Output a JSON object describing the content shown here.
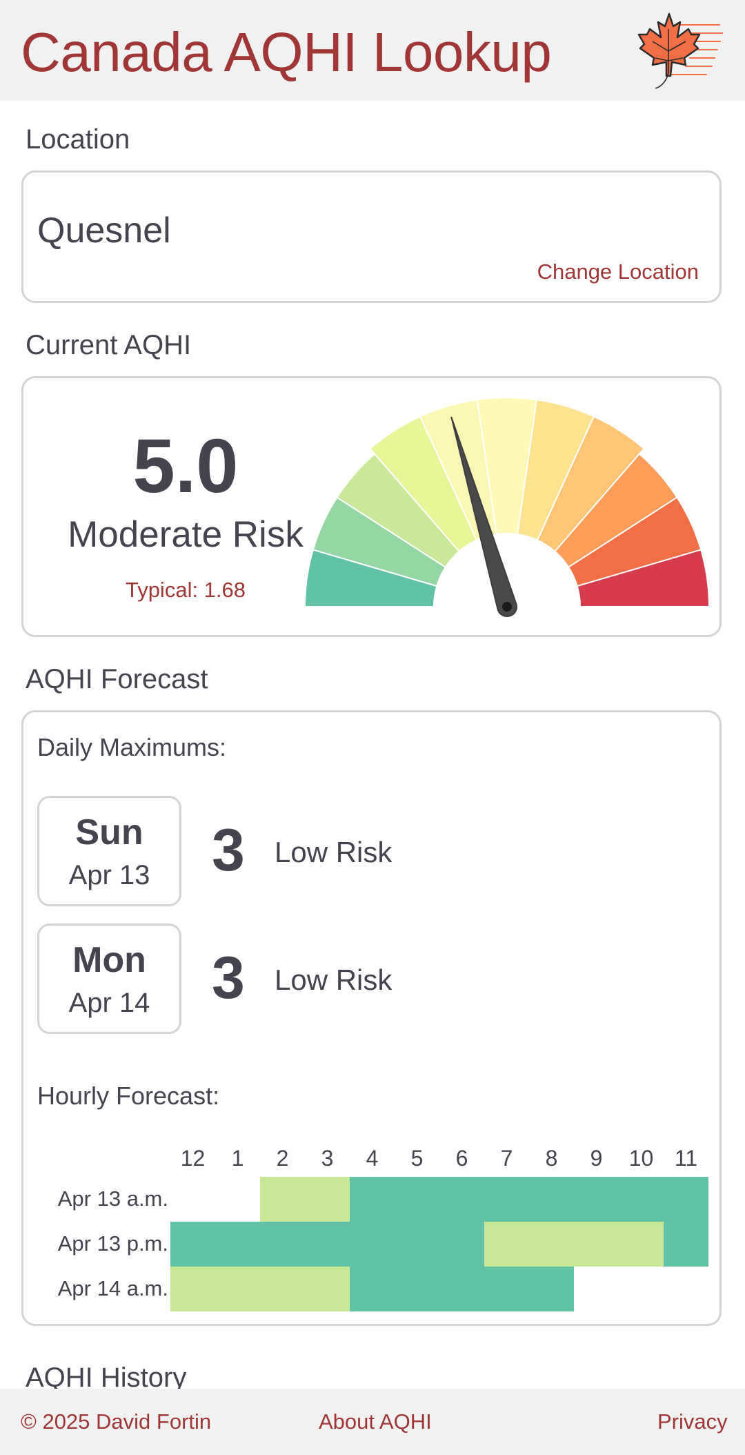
{
  "header": {
    "title": "Canada AQHI Lookup",
    "logo_icon": "maple-leaf-icon",
    "brand_color": "#a03635"
  },
  "location": {
    "section_title": "Location",
    "name": "Quesnel",
    "change_label": "Change Location"
  },
  "current": {
    "section_title": "Current AQHI",
    "value": "5.0",
    "risk": "Moderate Risk",
    "typical": "Typical: 1.68",
    "gauge_value": 5.0,
    "gauge_max": 11,
    "gauge_colors": [
      "#62c2a6",
      "#94d6a4",
      "#c9e899",
      "#e8f599",
      "#fbf8b5",
      "#fef9b7",
      "#fde28f",
      "#fdc575",
      "#fc9e5a",
      "#f26e45",
      "#d73c4d"
    ]
  },
  "forecast": {
    "section_title": "AQHI Forecast",
    "daily_label": "Daily Maximums:",
    "days": [
      {
        "name": "Sun",
        "date": "Apr 13",
        "value": "3",
        "risk": "Low Risk"
      },
      {
        "name": "Mon",
        "date": "Apr 14",
        "value": "3",
        "risk": "Low Risk"
      }
    ],
    "hourly_label": "Hourly Forecast:",
    "hours": [
      "12",
      "1",
      "2",
      "3",
      "4",
      "5",
      "6",
      "7",
      "8",
      "9",
      "10",
      "11"
    ],
    "level_colors": {
      "1": "#62c2a6",
      "2": "#c8e897"
    },
    "rows": [
      {
        "label": "Apr 13 a.m.",
        "levels": [
          0,
          0,
          2,
          2,
          1,
          1,
          1,
          1,
          1,
          1,
          1,
          1
        ]
      },
      {
        "label": "Apr 13 p.m.",
        "levels": [
          1,
          1,
          1,
          1,
          1,
          1,
          1,
          2,
          2,
          2,
          2,
          1
        ]
      },
      {
        "label": "Apr 14 a.m.",
        "levels": [
          2,
          2,
          2,
          2,
          1,
          1,
          1,
          1,
          1,
          0,
          0,
          0
        ]
      }
    ]
  },
  "history": {
    "section_title": "AQHI History"
  },
  "footer": {
    "copyright": "© 2025 David Fortin",
    "about": "About AQHI",
    "privacy": "Privacy"
  }
}
